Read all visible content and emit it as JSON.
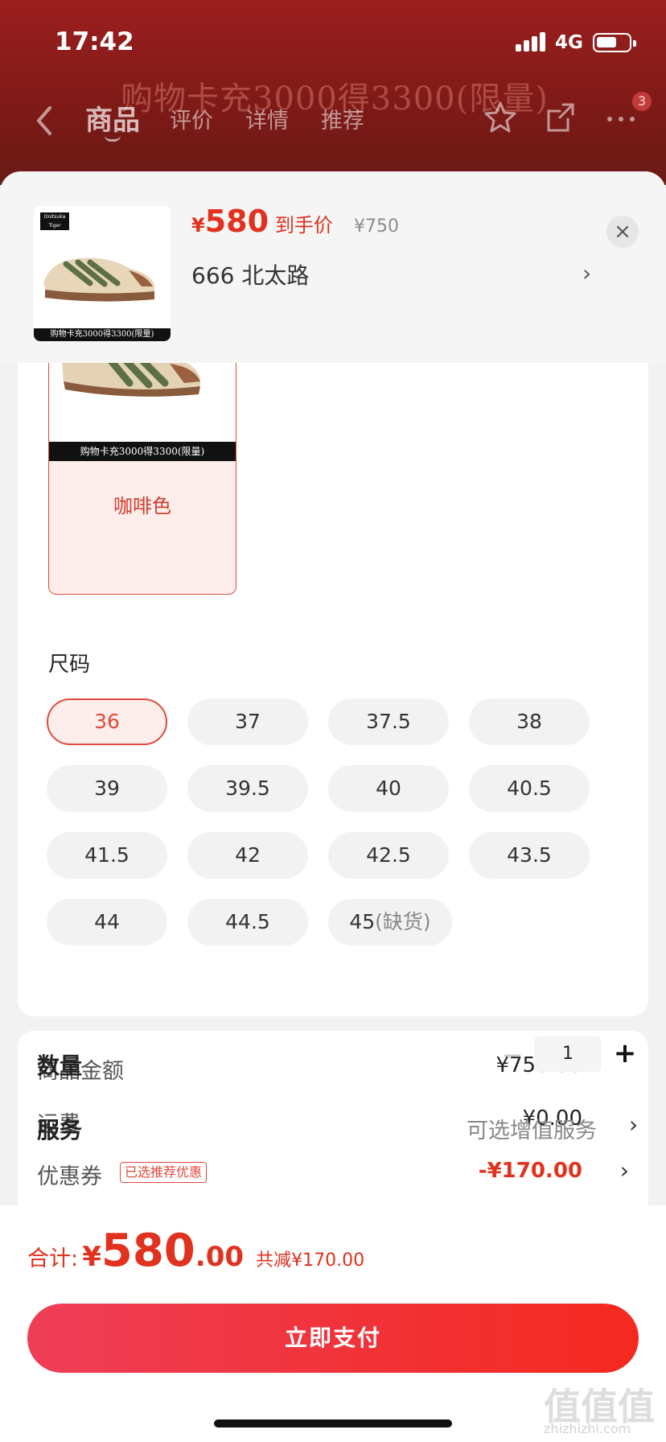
{
  "status_bar": {
    "time": "17:42",
    "network": "4G"
  },
  "background_page": {
    "banner_text": "购物卡充3000得3300(限量)",
    "tabs": [
      {
        "label": "商品",
        "active": true
      },
      {
        "label": "评价",
        "active": false
      },
      {
        "label": "详情",
        "active": false
      },
      {
        "label": "推荐",
        "active": false
      }
    ],
    "badge_count": "3"
  },
  "product": {
    "thumb_caption": "购物卡充3000得3300(限量)",
    "brand_logo_text": "Onitsuka Tiger",
    "price_symbol": "¥",
    "price": "580",
    "price_tag": "到手价",
    "original_price": "¥750",
    "selected_variant": "666  北太路",
    "arrow": "›",
    "close_glyph": "×"
  },
  "color_option": {
    "caption": "购物卡充3000得3300(限量)",
    "label": "咖啡色"
  },
  "size": {
    "title": "尺码",
    "options": [
      "36",
      "37",
      "37.5",
      "38",
      "39",
      "39.5",
      "40",
      "40.5",
      "41.5",
      "42",
      "42.5",
      "43.5",
      "44",
      "44.5",
      "45"
    ],
    "selected": "36",
    "out_of_stock_note": "(缺货)"
  },
  "quantity": {
    "label": "数量",
    "minus": "−",
    "value": "1",
    "plus": "+"
  },
  "service": {
    "label": "服务",
    "value": "可选增值服务",
    "arrow": "›"
  },
  "amounts": {
    "goods_label": "商品金额",
    "goods_value": "¥750.00",
    "shipping_label": "运费",
    "shipping_value": "¥0.00",
    "coupon_label": "优惠券",
    "coupon_tag": "已选推荐优惠",
    "coupon_value": "-¥170.00",
    "arrow": "›"
  },
  "footer": {
    "total_label": "合计:",
    "total_yen": "¥",
    "total_int": "580",
    "total_dec": ".00",
    "saving": "共减¥170.00",
    "pay_label": "立即支付"
  },
  "watermark": {
    "text": "值值值",
    "sub": "zhizhizhi.com"
  },
  "colors": {
    "accent": "#e0321e",
    "pay_start": "#ee3e57",
    "pay_end": "#f4291f"
  }
}
